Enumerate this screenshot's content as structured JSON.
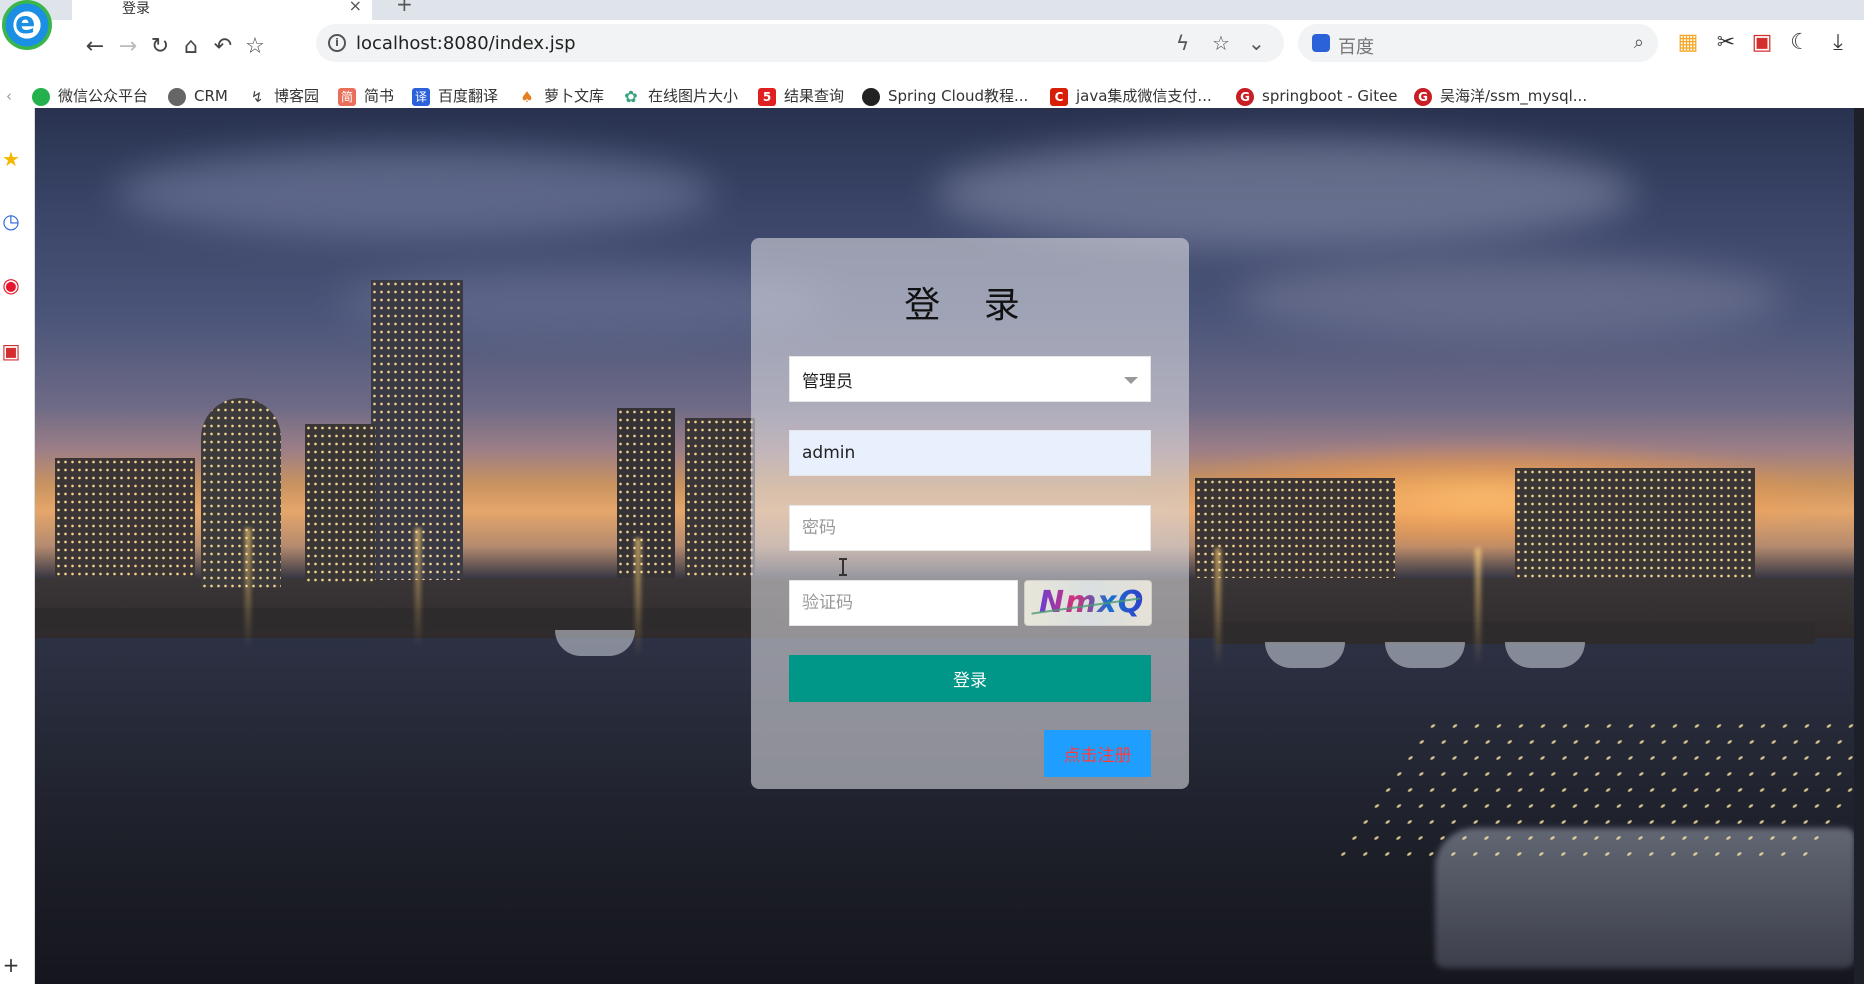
{
  "browser": {
    "tab_title": "登录",
    "tab_close": "×",
    "new_tab": "+",
    "address": "localhost:8080/index.jsp",
    "search_placeholder": "百度",
    "logo_letter": "e"
  },
  "bookmarks": [
    {
      "label": "微信公众平台",
      "icon": "wechat-icon",
      "color": "#22b14c"
    },
    {
      "label": "CRM",
      "icon": "globe-icon",
      "color": "#555555"
    },
    {
      "label": "博客园",
      "icon": "cnblogs-icon",
      "color": "#444444"
    },
    {
      "label": "简书",
      "icon": "jianshu-icon",
      "color": "#ea6f5a"
    },
    {
      "label": "百度翻译",
      "icon": "translate-icon",
      "color": "#2b62d9"
    },
    {
      "label": "萝卜文库",
      "icon": "carrot-icon",
      "color": "#e67e22"
    },
    {
      "label": "在线图片大小",
      "icon": "flower-icon",
      "color": "#3aa17e"
    },
    {
      "label": "结果查询",
      "icon": "five-icon",
      "color": "#e02020"
    },
    {
      "label": "Spring Cloud教程...",
      "icon": "github-icon",
      "color": "#222222"
    },
    {
      "label": "java集成微信支付...",
      "icon": "csdn-icon",
      "color": "#d81e06"
    },
    {
      "label": "springboot - Gitee",
      "icon": "gitee-icon",
      "color": "#c71d23"
    },
    {
      "label": "吴海洋/ssm_mysql...",
      "icon": "gitee-icon",
      "color": "#c71d23"
    }
  ],
  "login": {
    "title": "登 录",
    "role_selected": "管理员",
    "username_value": "admin",
    "password_placeholder": "密码",
    "captcha_placeholder": "验证码",
    "captcha_text": "NmxQ",
    "login_button": "登录",
    "register_button": "点击注册"
  },
  "colors": {
    "login_button": "#009688",
    "register_button": "#1e9fff",
    "register_text": "#ff3b3b"
  }
}
